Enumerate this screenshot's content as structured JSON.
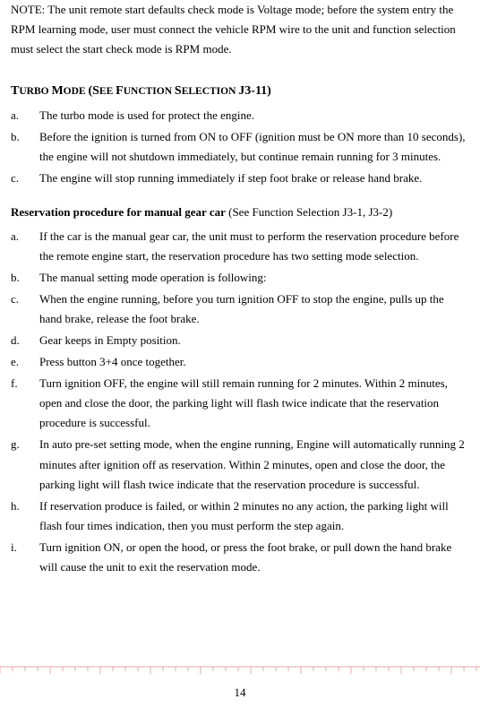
{
  "note": "NOTE: The unit remote start defaults check mode is Voltage mode; before the system entry the RPM learning mode, user must connect the vehicle RPM wire to the unit and function selection must select the start check mode is RPM mode.",
  "turbo": {
    "heading_before": "T",
    "heading_sc1": "URBO ",
    "heading_mid1": "M",
    "heading_sc2": "ODE ",
    "heading_paren": "(S",
    "heading_sc3": "EE ",
    "heading_f": "F",
    "heading_sc4": "UNCTION ",
    "heading_s": "S",
    "heading_sc5": "ELECTION ",
    "heading_j": "J3-11)",
    "items": [
      {
        "label": "a.",
        "content": "The turbo mode is used for protect the engine."
      },
      {
        "label": "b.",
        "content": "Before the ignition is turned from ON to OFF (ignition must be ON more than 10 seconds), the engine will not shutdown immediately, but continue remain running for 3 minutes."
      },
      {
        "label": "c.",
        "content": "The engine will stop running immediately if step foot brake or release hand brake."
      }
    ]
  },
  "reservation": {
    "heading": "Reservation procedure for manual gear car",
    "heading_tail": " (See Function Selection J3-1, J3-2)",
    "items": [
      {
        "label": "a.",
        "content": "If the car is the manual gear car, the unit must to perform the reservation procedure before the remote engine start, the reservation procedure has two setting mode selection."
      },
      {
        "label": "b.",
        "content": "The manual setting mode operation is following:"
      },
      {
        "label": "c.",
        "content": "When the engine running, before you turn ignition OFF to stop the engine, pulls up the hand brake, release the foot brake."
      },
      {
        "label": "d.",
        "content": "Gear keeps in Empty position."
      },
      {
        "label": "e.",
        "content": "Press button 3+4 once together."
      },
      {
        "label": "f.",
        "content": "Turn ignition OFF, the engine will still remain running for 2 minutes. Within 2 minutes, open and close the door, the parking light will flash twice indicate that the reservation procedure is successful."
      },
      {
        "label": "g.",
        "content": "In auto pre-set setting mode, when the engine running, Engine will automatically running 2 minutes after ignition off as reservation. Within 2 minutes, open and close the door, the parking light will flash twice indicate that the reservation procedure is successful."
      },
      {
        "label": "h.",
        "content": "If reservation produce is failed, or within 2 minutes no any action, the parking light will flash four times indication, then you must perform the step again."
      },
      {
        "label": "i.",
        "content": "Turn ignition ON, or open the hood, or press the foot brake, or pull down the hand brake will cause the unit to exit the reservation mode."
      }
    ]
  },
  "page_number": "14"
}
